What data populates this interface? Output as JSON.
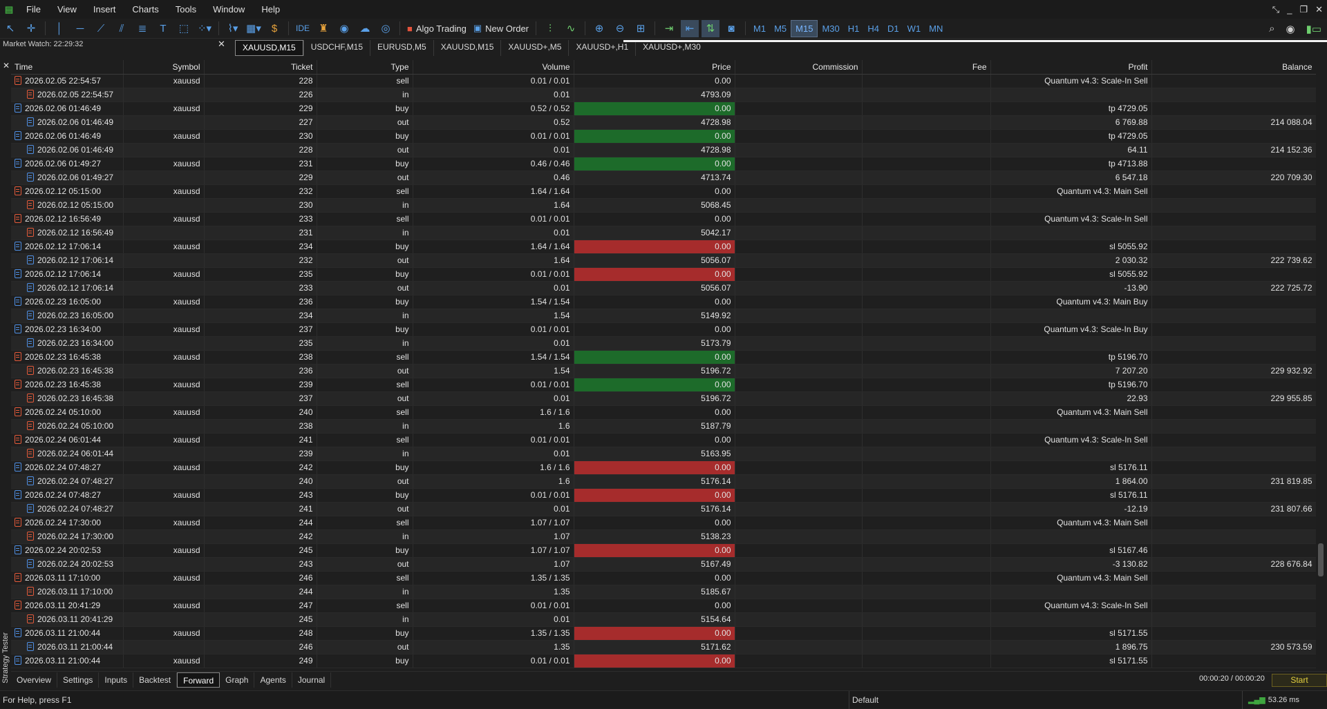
{
  "menu": [
    "File",
    "View",
    "Insert",
    "Charts",
    "Tools",
    "Window",
    "Help"
  ],
  "toolbar": {
    "ide": "IDE",
    "algo_trading": "Algo Trading",
    "new_order": "New Order",
    "timeframes": [
      "M1",
      "M5",
      "M15",
      "M30",
      "H1",
      "H4",
      "D1",
      "W1",
      "MN"
    ],
    "active_timeframe": "M15"
  },
  "market_watch": {
    "title": "Market Watch: 22:29:32"
  },
  "chart_tabs": [
    "XAUUSD,M15",
    "USDCHF,M15",
    "EURUSD,M5",
    "XAUUSD,M15",
    "XAUUSD+,M5",
    "XAUUSD+,H1",
    "XAUUSD+,M30"
  ],
  "active_chart_tab": 0,
  "columns": [
    "Time",
    "Symbol",
    "Ticket",
    "Type",
    "Volume",
    "Price",
    "Commission",
    "Fee",
    "Profit",
    "Balance"
  ],
  "rows": [
    {
      "kind": "order",
      "dir": "sell",
      "time": "2026.02.05 22:54:57",
      "symbol": "xauusd",
      "ticket": "228",
      "type": "sell",
      "volume": "0.01 / 0.01",
      "price": "0.00",
      "hl": "",
      "profit": "Quantum v4.3: Scale-In Sell",
      "balance": ""
    },
    {
      "kind": "deal",
      "dir": "sell",
      "time": "2026.02.05 22:54:57",
      "symbol": "",
      "ticket": "226",
      "type": "in",
      "volume": "0.01",
      "price": "4793.09",
      "hl": "",
      "profit": "",
      "balance": ""
    },
    {
      "kind": "order",
      "dir": "buy",
      "time": "2026.02.06 01:46:49",
      "symbol": "xauusd",
      "ticket": "229",
      "type": "buy",
      "volume": "0.52 / 0.52",
      "price": "0.00",
      "hl": "green",
      "profit": "tp 4729.05",
      "balance": ""
    },
    {
      "kind": "deal",
      "dir": "buy",
      "time": "2026.02.06 01:46:49",
      "symbol": "",
      "ticket": "227",
      "type": "out",
      "volume": "0.52",
      "price": "4728.98",
      "hl": "",
      "profit": "6 769.88",
      "balance": "214 088.04"
    },
    {
      "kind": "order",
      "dir": "buy",
      "time": "2026.02.06 01:46:49",
      "symbol": "xauusd",
      "ticket": "230",
      "type": "buy",
      "volume": "0.01 / 0.01",
      "price": "0.00",
      "hl": "green",
      "profit": "tp 4729.05",
      "balance": ""
    },
    {
      "kind": "deal",
      "dir": "buy",
      "time": "2026.02.06 01:46:49",
      "symbol": "",
      "ticket": "228",
      "type": "out",
      "volume": "0.01",
      "price": "4728.98",
      "hl": "",
      "profit": "64.11",
      "balance": "214 152.36"
    },
    {
      "kind": "order",
      "dir": "buy",
      "time": "2026.02.06 01:49:27",
      "symbol": "xauusd",
      "ticket": "231",
      "type": "buy",
      "volume": "0.46 / 0.46",
      "price": "0.00",
      "hl": "green",
      "profit": "tp 4713.88",
      "balance": ""
    },
    {
      "kind": "deal",
      "dir": "buy",
      "time": "2026.02.06 01:49:27",
      "symbol": "",
      "ticket": "229",
      "type": "out",
      "volume": "0.46",
      "price": "4713.74",
      "hl": "",
      "profit": "6 547.18",
      "balance": "220 709.30"
    },
    {
      "kind": "order",
      "dir": "sell",
      "time": "2026.02.12 05:15:00",
      "symbol": "xauusd",
      "ticket": "232",
      "type": "sell",
      "volume": "1.64 / 1.64",
      "price": "0.00",
      "hl": "",
      "profit": "Quantum v4.3: Main Sell",
      "balance": ""
    },
    {
      "kind": "deal",
      "dir": "sell",
      "time": "2026.02.12 05:15:00",
      "symbol": "",
      "ticket": "230",
      "type": "in",
      "volume": "1.64",
      "price": "5068.45",
      "hl": "",
      "profit": "",
      "balance": ""
    },
    {
      "kind": "order",
      "dir": "sell",
      "time": "2026.02.12 16:56:49",
      "symbol": "xauusd",
      "ticket": "233",
      "type": "sell",
      "volume": "0.01 / 0.01",
      "price": "0.00",
      "hl": "",
      "profit": "Quantum v4.3: Scale-In Sell",
      "balance": ""
    },
    {
      "kind": "deal",
      "dir": "sell",
      "time": "2026.02.12 16:56:49",
      "symbol": "",
      "ticket": "231",
      "type": "in",
      "volume": "0.01",
      "price": "5042.17",
      "hl": "",
      "profit": "",
      "balance": ""
    },
    {
      "kind": "order",
      "dir": "buy",
      "time": "2026.02.12 17:06:14",
      "symbol": "xauusd",
      "ticket": "234",
      "type": "buy",
      "volume": "1.64 / 1.64",
      "price": "0.00",
      "hl": "red",
      "profit": "sl 5055.92",
      "balance": ""
    },
    {
      "kind": "deal",
      "dir": "buy",
      "time": "2026.02.12 17:06:14",
      "symbol": "",
      "ticket": "232",
      "type": "out",
      "volume": "1.64",
      "price": "5056.07",
      "hl": "",
      "profit": "2 030.32",
      "balance": "222 739.62"
    },
    {
      "kind": "order",
      "dir": "buy",
      "time": "2026.02.12 17:06:14",
      "symbol": "xauusd",
      "ticket": "235",
      "type": "buy",
      "volume": "0.01 / 0.01",
      "price": "0.00",
      "hl": "red",
      "profit": "sl 5055.92",
      "balance": ""
    },
    {
      "kind": "deal",
      "dir": "buy",
      "time": "2026.02.12 17:06:14",
      "symbol": "",
      "ticket": "233",
      "type": "out",
      "volume": "0.01",
      "price": "5056.07",
      "hl": "",
      "profit": "-13.90",
      "balance": "222 725.72"
    },
    {
      "kind": "order",
      "dir": "buy",
      "time": "2026.02.23 16:05:00",
      "symbol": "xauusd",
      "ticket": "236",
      "type": "buy",
      "volume": "1.54 / 1.54",
      "price": "0.00",
      "hl": "",
      "profit": "Quantum v4.3: Main Buy",
      "balance": ""
    },
    {
      "kind": "deal",
      "dir": "buy",
      "time": "2026.02.23 16:05:00",
      "symbol": "",
      "ticket": "234",
      "type": "in",
      "volume": "1.54",
      "price": "5149.92",
      "hl": "",
      "profit": "",
      "balance": ""
    },
    {
      "kind": "order",
      "dir": "buy",
      "time": "2026.02.23 16:34:00",
      "symbol": "xauusd",
      "ticket": "237",
      "type": "buy",
      "volume": "0.01 / 0.01",
      "price": "0.00",
      "hl": "",
      "profit": "Quantum v4.3: Scale-In Buy",
      "balance": ""
    },
    {
      "kind": "deal",
      "dir": "buy",
      "time": "2026.02.23 16:34:00",
      "symbol": "",
      "ticket": "235",
      "type": "in",
      "volume": "0.01",
      "price": "5173.79",
      "hl": "",
      "profit": "",
      "balance": ""
    },
    {
      "kind": "order",
      "dir": "sell",
      "time": "2026.02.23 16:45:38",
      "symbol": "xauusd",
      "ticket": "238",
      "type": "sell",
      "volume": "1.54 / 1.54",
      "price": "0.00",
      "hl": "green",
      "profit": "tp 5196.70",
      "balance": ""
    },
    {
      "kind": "deal",
      "dir": "sell",
      "time": "2026.02.23 16:45:38",
      "symbol": "",
      "ticket": "236",
      "type": "out",
      "volume": "1.54",
      "price": "5196.72",
      "hl": "",
      "profit": "7 207.20",
      "balance": "229 932.92"
    },
    {
      "kind": "order",
      "dir": "sell",
      "time": "2026.02.23 16:45:38",
      "symbol": "xauusd",
      "ticket": "239",
      "type": "sell",
      "volume": "0.01 / 0.01",
      "price": "0.00",
      "hl": "green",
      "profit": "tp 5196.70",
      "balance": ""
    },
    {
      "kind": "deal",
      "dir": "sell",
      "time": "2026.02.23 16:45:38",
      "symbol": "",
      "ticket": "237",
      "type": "out",
      "volume": "0.01",
      "price": "5196.72",
      "hl": "",
      "profit": "22.93",
      "balance": "229 955.85"
    },
    {
      "kind": "order",
      "dir": "sell",
      "time": "2026.02.24 05:10:00",
      "symbol": "xauusd",
      "ticket": "240",
      "type": "sell",
      "volume": "1.6 / 1.6",
      "price": "0.00",
      "hl": "",
      "profit": "Quantum v4.3: Main Sell",
      "balance": ""
    },
    {
      "kind": "deal",
      "dir": "sell",
      "time": "2026.02.24 05:10:00",
      "symbol": "",
      "ticket": "238",
      "type": "in",
      "volume": "1.6",
      "price": "5187.79",
      "hl": "",
      "profit": "",
      "balance": ""
    },
    {
      "kind": "order",
      "dir": "sell",
      "time": "2026.02.24 06:01:44",
      "symbol": "xauusd",
      "ticket": "241",
      "type": "sell",
      "volume": "0.01 / 0.01",
      "price": "0.00",
      "hl": "",
      "profit": "Quantum v4.3: Scale-In Sell",
      "balance": ""
    },
    {
      "kind": "deal",
      "dir": "sell",
      "time": "2026.02.24 06:01:44",
      "symbol": "",
      "ticket": "239",
      "type": "in",
      "volume": "0.01",
      "price": "5163.95",
      "hl": "",
      "profit": "",
      "balance": ""
    },
    {
      "kind": "order",
      "dir": "buy",
      "time": "2026.02.24 07:48:27",
      "symbol": "xauusd",
      "ticket": "242",
      "type": "buy",
      "volume": "1.6 / 1.6",
      "price": "0.00",
      "hl": "red",
      "profit": "sl 5176.11",
      "balance": ""
    },
    {
      "kind": "deal",
      "dir": "buy",
      "time": "2026.02.24 07:48:27",
      "symbol": "",
      "ticket": "240",
      "type": "out",
      "volume": "1.6",
      "price": "5176.14",
      "hl": "",
      "profit": "1 864.00",
      "balance": "231 819.85"
    },
    {
      "kind": "order",
      "dir": "buy",
      "time": "2026.02.24 07:48:27",
      "symbol": "xauusd",
      "ticket": "243",
      "type": "buy",
      "volume": "0.01 / 0.01",
      "price": "0.00",
      "hl": "red",
      "profit": "sl 5176.11",
      "balance": ""
    },
    {
      "kind": "deal",
      "dir": "buy",
      "time": "2026.02.24 07:48:27",
      "symbol": "",
      "ticket": "241",
      "type": "out",
      "volume": "0.01",
      "price": "5176.14",
      "hl": "",
      "profit": "-12.19",
      "balance": "231 807.66"
    },
    {
      "kind": "order",
      "dir": "sell",
      "time": "2026.02.24 17:30:00",
      "symbol": "xauusd",
      "ticket": "244",
      "type": "sell",
      "volume": "1.07 / 1.07",
      "price": "0.00",
      "hl": "",
      "profit": "Quantum v4.3: Main Sell",
      "balance": ""
    },
    {
      "kind": "deal",
      "dir": "sell",
      "time": "2026.02.24 17:30:00",
      "symbol": "",
      "ticket": "242",
      "type": "in",
      "volume": "1.07",
      "price": "5138.23",
      "hl": "",
      "profit": "",
      "balance": ""
    },
    {
      "kind": "order",
      "dir": "buy",
      "time": "2026.02.24 20:02:53",
      "symbol": "xauusd",
      "ticket": "245",
      "type": "buy",
      "volume": "1.07 / 1.07",
      "price": "0.00",
      "hl": "red",
      "profit": "sl 5167.46",
      "balance": ""
    },
    {
      "kind": "deal",
      "dir": "buy",
      "time": "2026.02.24 20:02:53",
      "symbol": "",
      "ticket": "243",
      "type": "out",
      "volume": "1.07",
      "price": "5167.49",
      "hl": "",
      "profit": "-3 130.82",
      "balance": "228 676.84"
    },
    {
      "kind": "order",
      "dir": "sell",
      "time": "2026.03.11 17:10:00",
      "symbol": "xauusd",
      "ticket": "246",
      "type": "sell",
      "volume": "1.35 / 1.35",
      "price": "0.00",
      "hl": "",
      "profit": "Quantum v4.3: Main Sell",
      "balance": ""
    },
    {
      "kind": "deal",
      "dir": "sell",
      "time": "2026.03.11 17:10:00",
      "symbol": "",
      "ticket": "244",
      "type": "in",
      "volume": "1.35",
      "price": "5185.67",
      "hl": "",
      "profit": "",
      "balance": ""
    },
    {
      "kind": "order",
      "dir": "sell",
      "time": "2026.03.11 20:41:29",
      "symbol": "xauusd",
      "ticket": "247",
      "type": "sell",
      "volume": "0.01 / 0.01",
      "price": "0.00",
      "hl": "",
      "profit": "Quantum v4.3: Scale-In Sell",
      "balance": ""
    },
    {
      "kind": "deal",
      "dir": "sell",
      "time": "2026.03.11 20:41:29",
      "symbol": "",
      "ticket": "245",
      "type": "in",
      "volume": "0.01",
      "price": "5154.64",
      "hl": "",
      "profit": "",
      "balance": ""
    },
    {
      "kind": "order",
      "dir": "buy",
      "time": "2026.03.11 21:00:44",
      "symbol": "xauusd",
      "ticket": "248",
      "type": "buy",
      "volume": "1.35 / 1.35",
      "price": "0.00",
      "hl": "red",
      "profit": "sl 5171.55",
      "balance": ""
    },
    {
      "kind": "deal",
      "dir": "buy",
      "time": "2026.03.11 21:00:44",
      "symbol": "",
      "ticket": "246",
      "type": "out",
      "volume": "1.35",
      "price": "5171.62",
      "hl": "",
      "profit": "1 896.75",
      "balance": "230 573.59"
    },
    {
      "kind": "order",
      "dir": "buy",
      "time": "2026.03.11 21:00:44",
      "symbol": "xauusd",
      "ticket": "249",
      "type": "buy",
      "volume": "0.01 / 0.01",
      "price": "0.00",
      "hl": "red",
      "profit": "sl 5171.55",
      "balance": ""
    }
  ],
  "bottom_tabs": [
    "Overview",
    "Settings",
    "Inputs",
    "Backtest",
    "Forward",
    "Graph",
    "Agents",
    "Journal"
  ],
  "active_bottom_tab": 4,
  "side_tab": "Strategy Tester",
  "timer": "00:00:20 / 00:00:20",
  "start_button": "Start",
  "status": {
    "help": "For Help, press F1",
    "profile": "Default",
    "ping": "53.26 ms"
  }
}
